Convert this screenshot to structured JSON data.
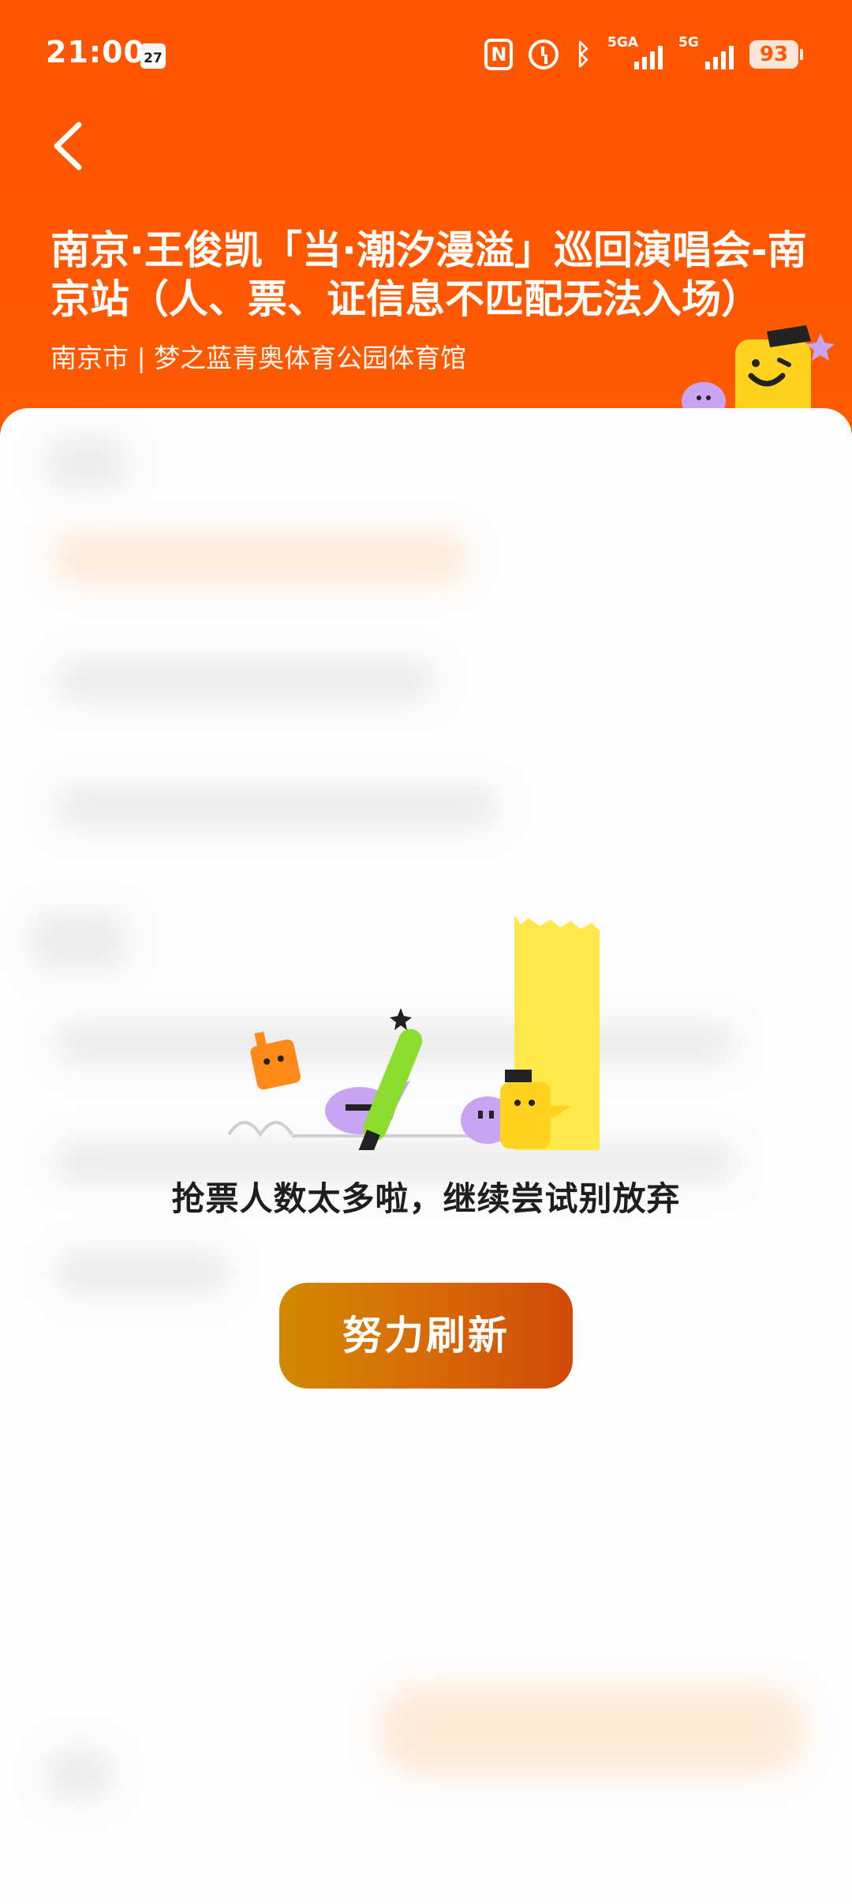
{
  "status_bar": {
    "time": "21:00",
    "calendar_day": "27",
    "signal_1_label": "5GA",
    "signal_2_label": "5G",
    "battery": "93"
  },
  "header": {
    "title": "南京·王俊凯「当·潮汐漫溢」巡回演唱会-南京站（人、票、证信息不匹配无法入场）",
    "subtitle": "南京市 | 梦之蓝青奥体育公园体育馆"
  },
  "empty_state": {
    "message": "抢票人数太多啦，继续尝试别放弃",
    "refresh_label": "努力刷新"
  },
  "colors": {
    "header_bg": "#ff5a00",
    "button_start": "#d08a00",
    "button_end": "#cf4a08"
  }
}
